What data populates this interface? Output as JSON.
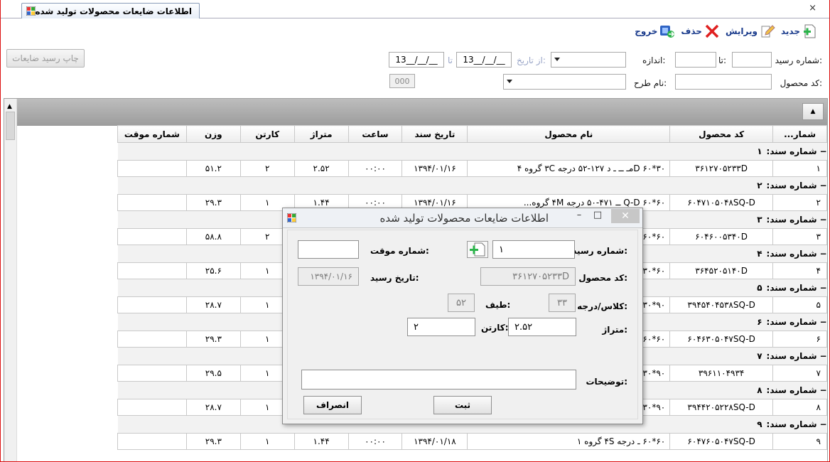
{
  "tab": {
    "title": "اطلاعات ضایعات محصولات تولید شده",
    "close": "×"
  },
  "toolbar": {
    "new": "جدید",
    "edit": "ویرایش",
    "delete": "حذف",
    "exit": "خروج"
  },
  "filter": {
    "receipt_no_label": "شماره رسید:",
    "to_label": "تا:",
    "size_label": "اندازه:",
    "from_date_label": "از تاریخ:",
    "date_from": "13__/__/__",
    "to_date_label": "تا",
    "date_to": "13__/__/__",
    "product_code_label": "کد محصول:",
    "design_name_label": "نام طرح:",
    "counter_value": "000",
    "print_button": "چاپ رسید ضایعات"
  },
  "grid": {
    "columns": [
      "شمار...",
      "کد محصول",
      "نام محصول",
      "تاریخ سند",
      "ساعت",
      "متراژ",
      "کارتن",
      "وزن",
      "شماره موقت"
    ],
    "group_label": "شماره سند:",
    "groups": [
      {
        "no": "۱",
        "row": [
          "۱",
          "۳۶۱۲۷۰۵۲۳۳D",
          "۳۰*۶۰ Dمـ ــ ـ د ۱۲۷-۵۲ درجه ۳C گروه ۴",
          "۱۳۹۴/۰۱/۱۶",
          "۰۰:۰۰",
          "۲.۵۲",
          "۲",
          "۵۱.۲",
          ""
        ]
      },
      {
        "no": "۲",
        "row": [
          "۲",
          "۶۰۴۷۱۰۵۰۴۸SQ-D",
          "۶۰*۶۰ Q-D ــ ۴۷۱-۵۰ درجه ۴M گروه...",
          "۱۳۹۴/۰۱/۱۶",
          "۰۰:۰۰",
          "۱.۴۴",
          "۱",
          "۲۹.۳",
          ""
        ]
      },
      {
        "no": "۳",
        "row": [
          "۳",
          "۶۰۴۶۰۰۵۳۴۰D",
          "۶۰*۶۰",
          "",
          "",
          "",
          "۲",
          "۵۸.۸",
          ""
        ]
      },
      {
        "no": "۴",
        "row": [
          "۴",
          "۳۶۴۵۲۰۵۱۴۰D",
          "۶۰*۳۰",
          "",
          "",
          "",
          "۱",
          "۲۵.۶",
          ""
        ]
      },
      {
        "no": "۵",
        "row": [
          "۵",
          "۳۹۴۵۴۰۴۵۳۸SQ-D",
          "۹۰*۳۰",
          "",
          "",
          "",
          "۱",
          "۲۸.۷",
          ""
        ]
      },
      {
        "no": "۶",
        "row": [
          "۶",
          "۶۰۴۶۳۰۵۰۴۷SQ-D",
          "۶۰*۶۰",
          "",
          "",
          "",
          "۱",
          "۲۹.۳",
          ""
        ]
      },
      {
        "no": "۷",
        "row": [
          "۷",
          "۳۹۶۱۱۰۴۹۳۴",
          "۹۰*۳۰",
          "",
          "",
          "",
          "۱",
          "۲۹.۵",
          ""
        ]
      },
      {
        "no": "۸",
        "row": [
          "۸",
          "۳۹۴۴۲۰۵۲۲۸SQ-D",
          "۹۰*۳۰",
          "",
          "",
          "",
          "۱",
          "۲۸.۷",
          ""
        ]
      },
      {
        "no": "۹",
        "row": [
          "۹",
          "۶۰۴۷۶۰۵۰۴۷SQ-D",
          "۶۰*۶۰ ـ درجه ۴S گروه ۱",
          "۱۳۹۴/۰۱/۱۸",
          "۰۰:۰۰",
          "۱.۴۴",
          "۱",
          "۲۹.۳",
          ""
        ]
      }
    ]
  },
  "dialog": {
    "title": "اطلاعات ضایعات محصولات تولید شده",
    "receipt_no_label": "شماره رسید:",
    "receipt_no": "۱",
    "temp_no_label": "شماره موقت:",
    "temp_no": "",
    "product_code_label": "کد محصول:",
    "product_code": "۳۶۱۲۷۰۵۲۳۳D",
    "receipt_date_label": "تاریخ رسید:",
    "receipt_date": "۱۳۹۴/۰۱/۱۶",
    "class_label": "کلاس/درجه:",
    "class_value": "۳۳",
    "shade_label": "طیف:",
    "shade_value": "۵۲",
    "meter_label": "متراژ:",
    "meter_value": "۲.۵۲",
    "carton_label": "کارتن:",
    "carton_value": "۲",
    "notes_label": "توضیحات:",
    "notes_value": "",
    "submit": "ثبت",
    "cancel": "انصراف",
    "minimize": "–",
    "maximize": "□",
    "close": "✕"
  },
  "colors": {
    "accent": "#1a3b8c",
    "border_red": "#dd1111"
  }
}
